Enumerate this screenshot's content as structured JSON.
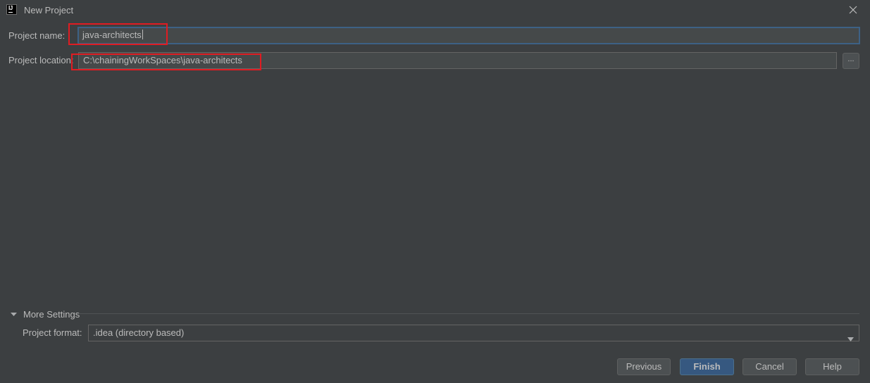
{
  "window": {
    "title": "New Project",
    "app_icon_text": "IJ"
  },
  "form": {
    "project_name_label": "Project name:",
    "project_name_value": "java-architects",
    "project_location_label": "Project location:",
    "project_location_value": "C:\\chainingWorkSpaces\\java-architects",
    "browse_label": "..."
  },
  "more_settings": {
    "label": "More Settings",
    "expanded": true,
    "project_format_label": "Project format:",
    "project_format_value": ".idea (directory based)"
  },
  "buttons": {
    "previous": "Previous",
    "finish": "Finish",
    "cancel": "Cancel",
    "help": "Help"
  },
  "colors": {
    "background": "#3c3f41",
    "text": "#bbbbbb",
    "field_bg": "#45494a",
    "focus_border": "#3d6185",
    "primary_button": "#365880",
    "highlight_annotation": "#e01c22"
  },
  "icons": {
    "app": "intellij-icon",
    "close": "close-icon",
    "toggle": "triangle-down-icon",
    "dropdown": "chevron-down-icon"
  }
}
